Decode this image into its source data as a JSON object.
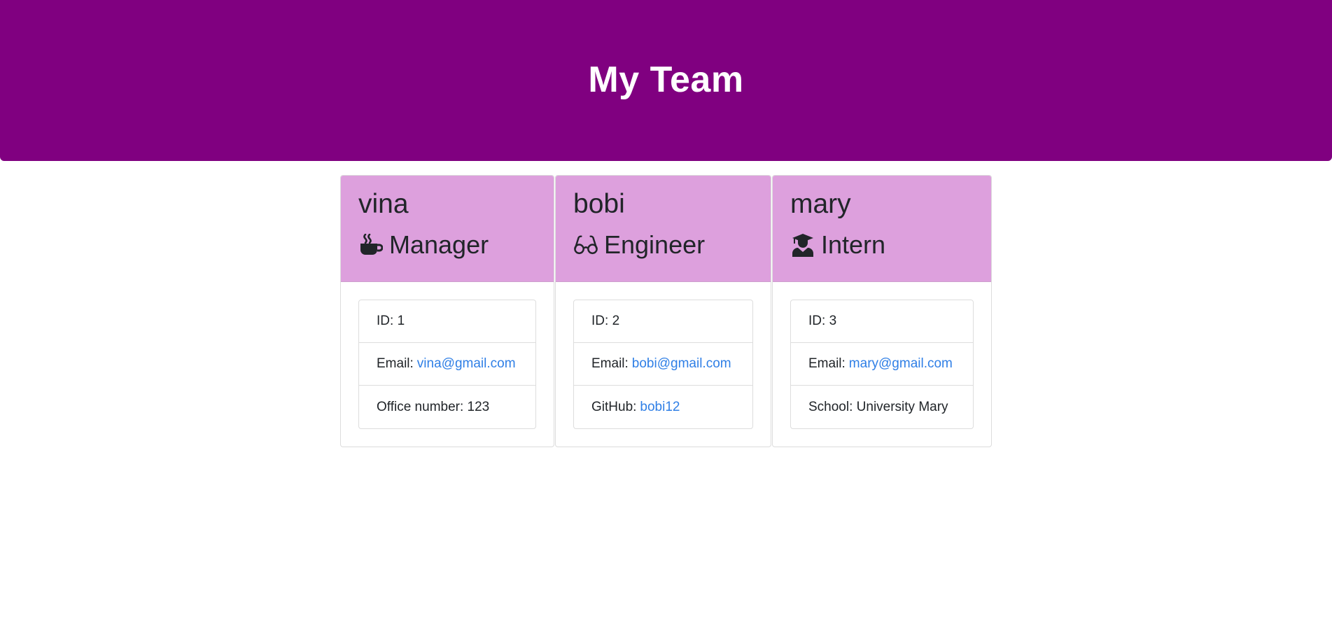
{
  "header": {
    "title": "My Team"
  },
  "colors": {
    "header_bg": "#800080",
    "card_header_bg": "#dda0dd",
    "link": "#2f7fe6"
  },
  "team": [
    {
      "name": "vina",
      "role": "Manager",
      "role_icon": "coffee-mug-icon",
      "id_label": "ID:",
      "id_value": "1",
      "email_label": "Email:",
      "email": "vina@gmail.com",
      "extra_label": "Office number:",
      "extra_value": "123"
    },
    {
      "name": "bobi",
      "role": "Engineer",
      "role_icon": "glasses-icon",
      "id_label": "ID:",
      "id_value": "2",
      "email_label": "Email:",
      "email": "bobi@gmail.com",
      "extra_label": "GitHub:",
      "extra_value": "bobi12"
    },
    {
      "name": "mary",
      "role": "Intern",
      "role_icon": "graduate-icon",
      "id_label": "ID:",
      "id_value": "3",
      "email_label": "Email:",
      "email": "mary@gmail.com",
      "extra_label": "School:",
      "extra_value": "University Mary"
    }
  ]
}
